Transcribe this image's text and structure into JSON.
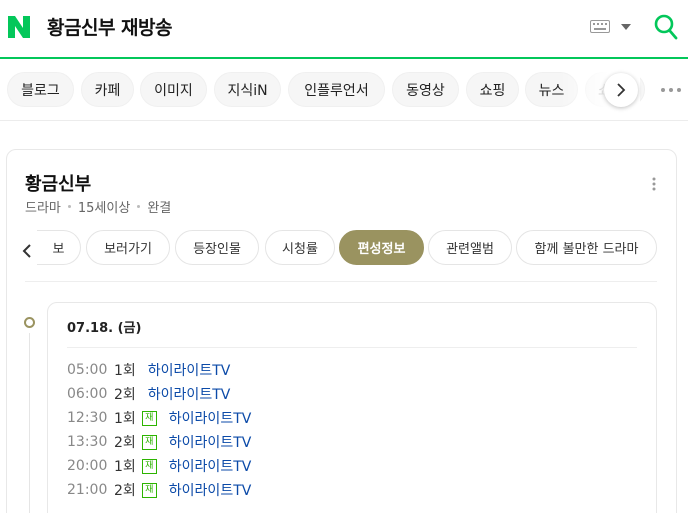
{
  "header": {
    "query": "황금신부 재방송",
    "logo_icon": "naver-n-logo-icon",
    "keyboard_icon": "keyboard-icon",
    "search_icon": "search-icon",
    "accent_color": "#03c75a"
  },
  "tabs": [
    {
      "label": "블로그"
    },
    {
      "label": "카페"
    },
    {
      "label": "이미지"
    },
    {
      "label": "지식iN"
    },
    {
      "label": "인플루언서"
    },
    {
      "label": "동영상"
    },
    {
      "label": "쇼핑"
    },
    {
      "label": "뉴스"
    },
    {
      "label": "쇼"
    }
  ],
  "card": {
    "title": "황금신부",
    "meta": [
      "드라마",
      "15세이상",
      "완결"
    ],
    "subtabs": [
      {
        "label": "보",
        "active": false
      },
      {
        "label": "보러가기",
        "active": false
      },
      {
        "label": "등장인물",
        "active": false
      },
      {
        "label": "시청률",
        "active": false
      },
      {
        "label": "편성정보",
        "active": true
      },
      {
        "label": "관련앨범",
        "active": false
      },
      {
        "label": "함께 볼만한 드라마",
        "active": false
      }
    ],
    "active_color": "#9a9360"
  },
  "schedule": {
    "date": "07.18. (금)",
    "rows": [
      {
        "time": "05:00",
        "episode": "1회",
        "rerun": false,
        "channel": "하이라이트TV"
      },
      {
        "time": "06:00",
        "episode": "2회",
        "rerun": false,
        "channel": "하이라이트TV"
      },
      {
        "time": "12:30",
        "episode": "1회",
        "rerun": true,
        "channel": "하이라이트TV"
      },
      {
        "time": "13:30",
        "episode": "2회",
        "rerun": true,
        "channel": "하이라이트TV"
      },
      {
        "time": "20:00",
        "episode": "1회",
        "rerun": true,
        "channel": "하이라이트TV"
      },
      {
        "time": "21:00",
        "episode": "2회",
        "rerun": true,
        "channel": "하이라이트TV"
      }
    ],
    "rerun_badge": "재"
  }
}
